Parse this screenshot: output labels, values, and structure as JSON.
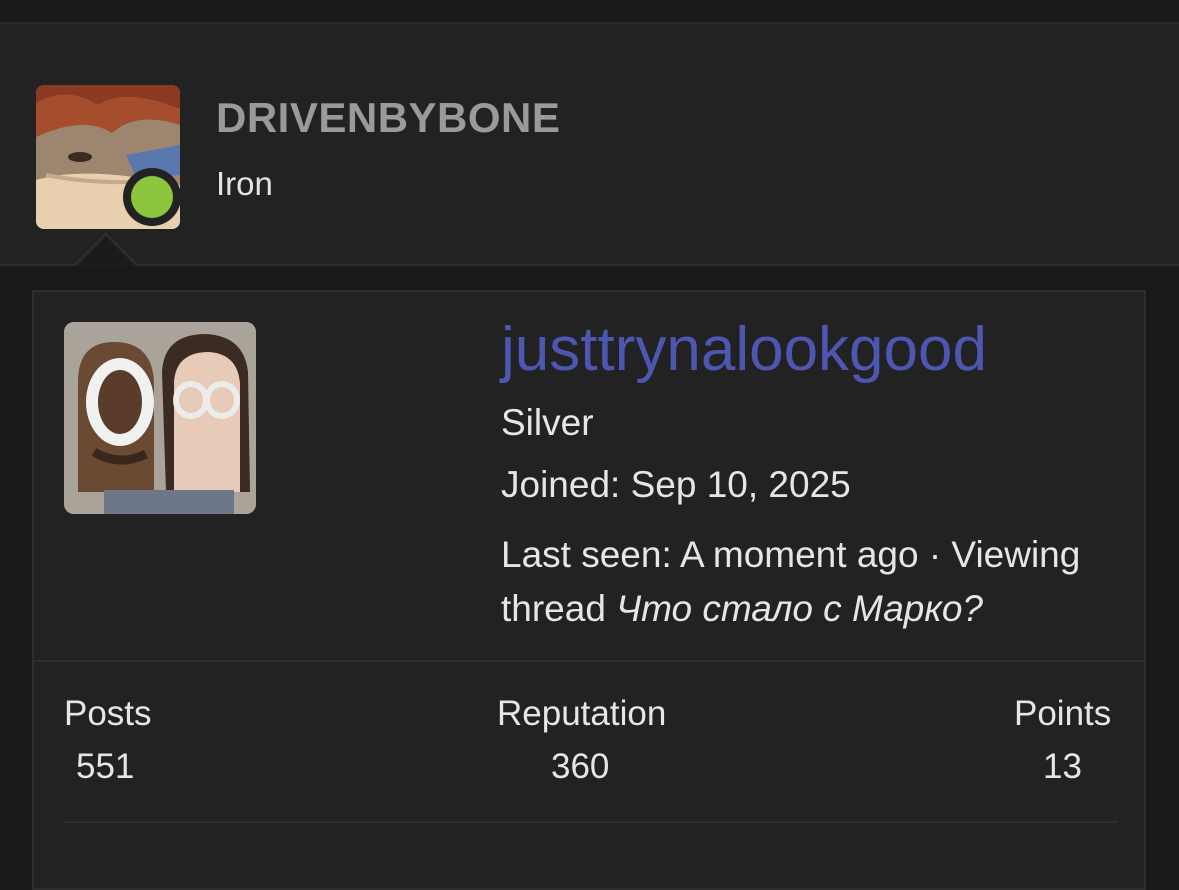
{
  "header_user": {
    "username": "DRIVENBYBONE",
    "rank": "Iron",
    "status": "online"
  },
  "profile": {
    "username": "justtrynalookgood",
    "rank": "Silver",
    "joined": "Joined: Sep 10, 2025",
    "last_seen_prefix": "Last seen: A moment ago · Viewing thread ",
    "last_seen_thread": "Что стало с Марко?"
  },
  "stats": {
    "posts_label": "Posts",
    "posts_value": "551",
    "reputation_label": "Reputation",
    "reputation_value": "360",
    "points_label": "Points",
    "points_value": "13"
  },
  "colors": {
    "background": "#191919",
    "card": "#222223",
    "profile_link": "#4d56b0",
    "online_dot": "#8cc63f",
    "muted_name": "#9a9a9a"
  }
}
